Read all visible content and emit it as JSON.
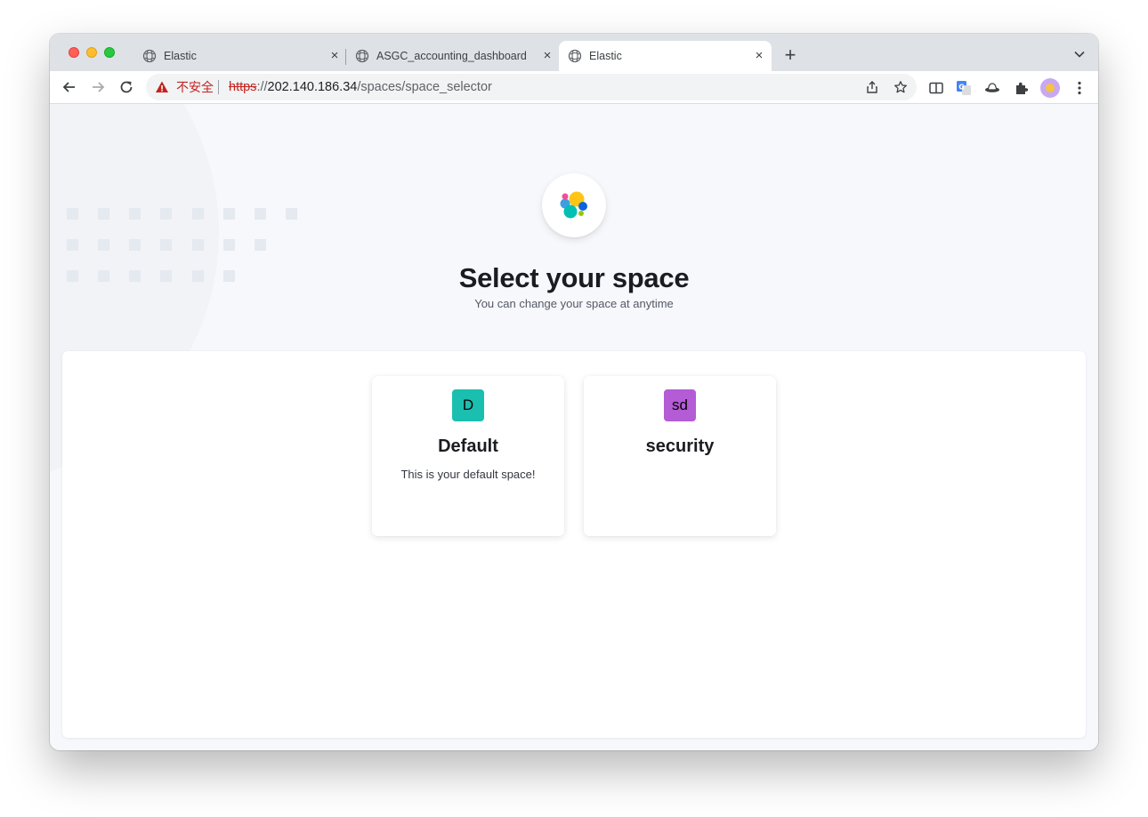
{
  "browser": {
    "tabs": [
      {
        "title": "Elastic",
        "icon": "elastic-tab-icon",
        "active": false
      },
      {
        "title": "ASGC_accounting_dashboard",
        "icon": "elastic-tab-icon",
        "active": false
      },
      {
        "title": "Elastic",
        "icon": "elastic-tab-icon",
        "active": true
      }
    ],
    "close_glyph": "×",
    "new_tab_glyph": "+",
    "address": {
      "security_label": "不安全",
      "scheme": "https",
      "separator": "://",
      "host": "202.140.186.34",
      "path": "/spaces/space_selector"
    }
  },
  "page": {
    "title": "Select your space",
    "subtitle": "You can change your space at anytime",
    "spaces": [
      {
        "initials": "D",
        "name": "Default",
        "description": "This is your default space!",
        "color": "#1bbfb0"
      },
      {
        "initials": "sd",
        "name": "security",
        "description": "",
        "color": "#b45bd6"
      }
    ]
  },
  "colors": {
    "insecure_red": "#c5221f",
    "page_bg": "#f7f8fc",
    "tabstrip_bg": "#dee1e6"
  }
}
